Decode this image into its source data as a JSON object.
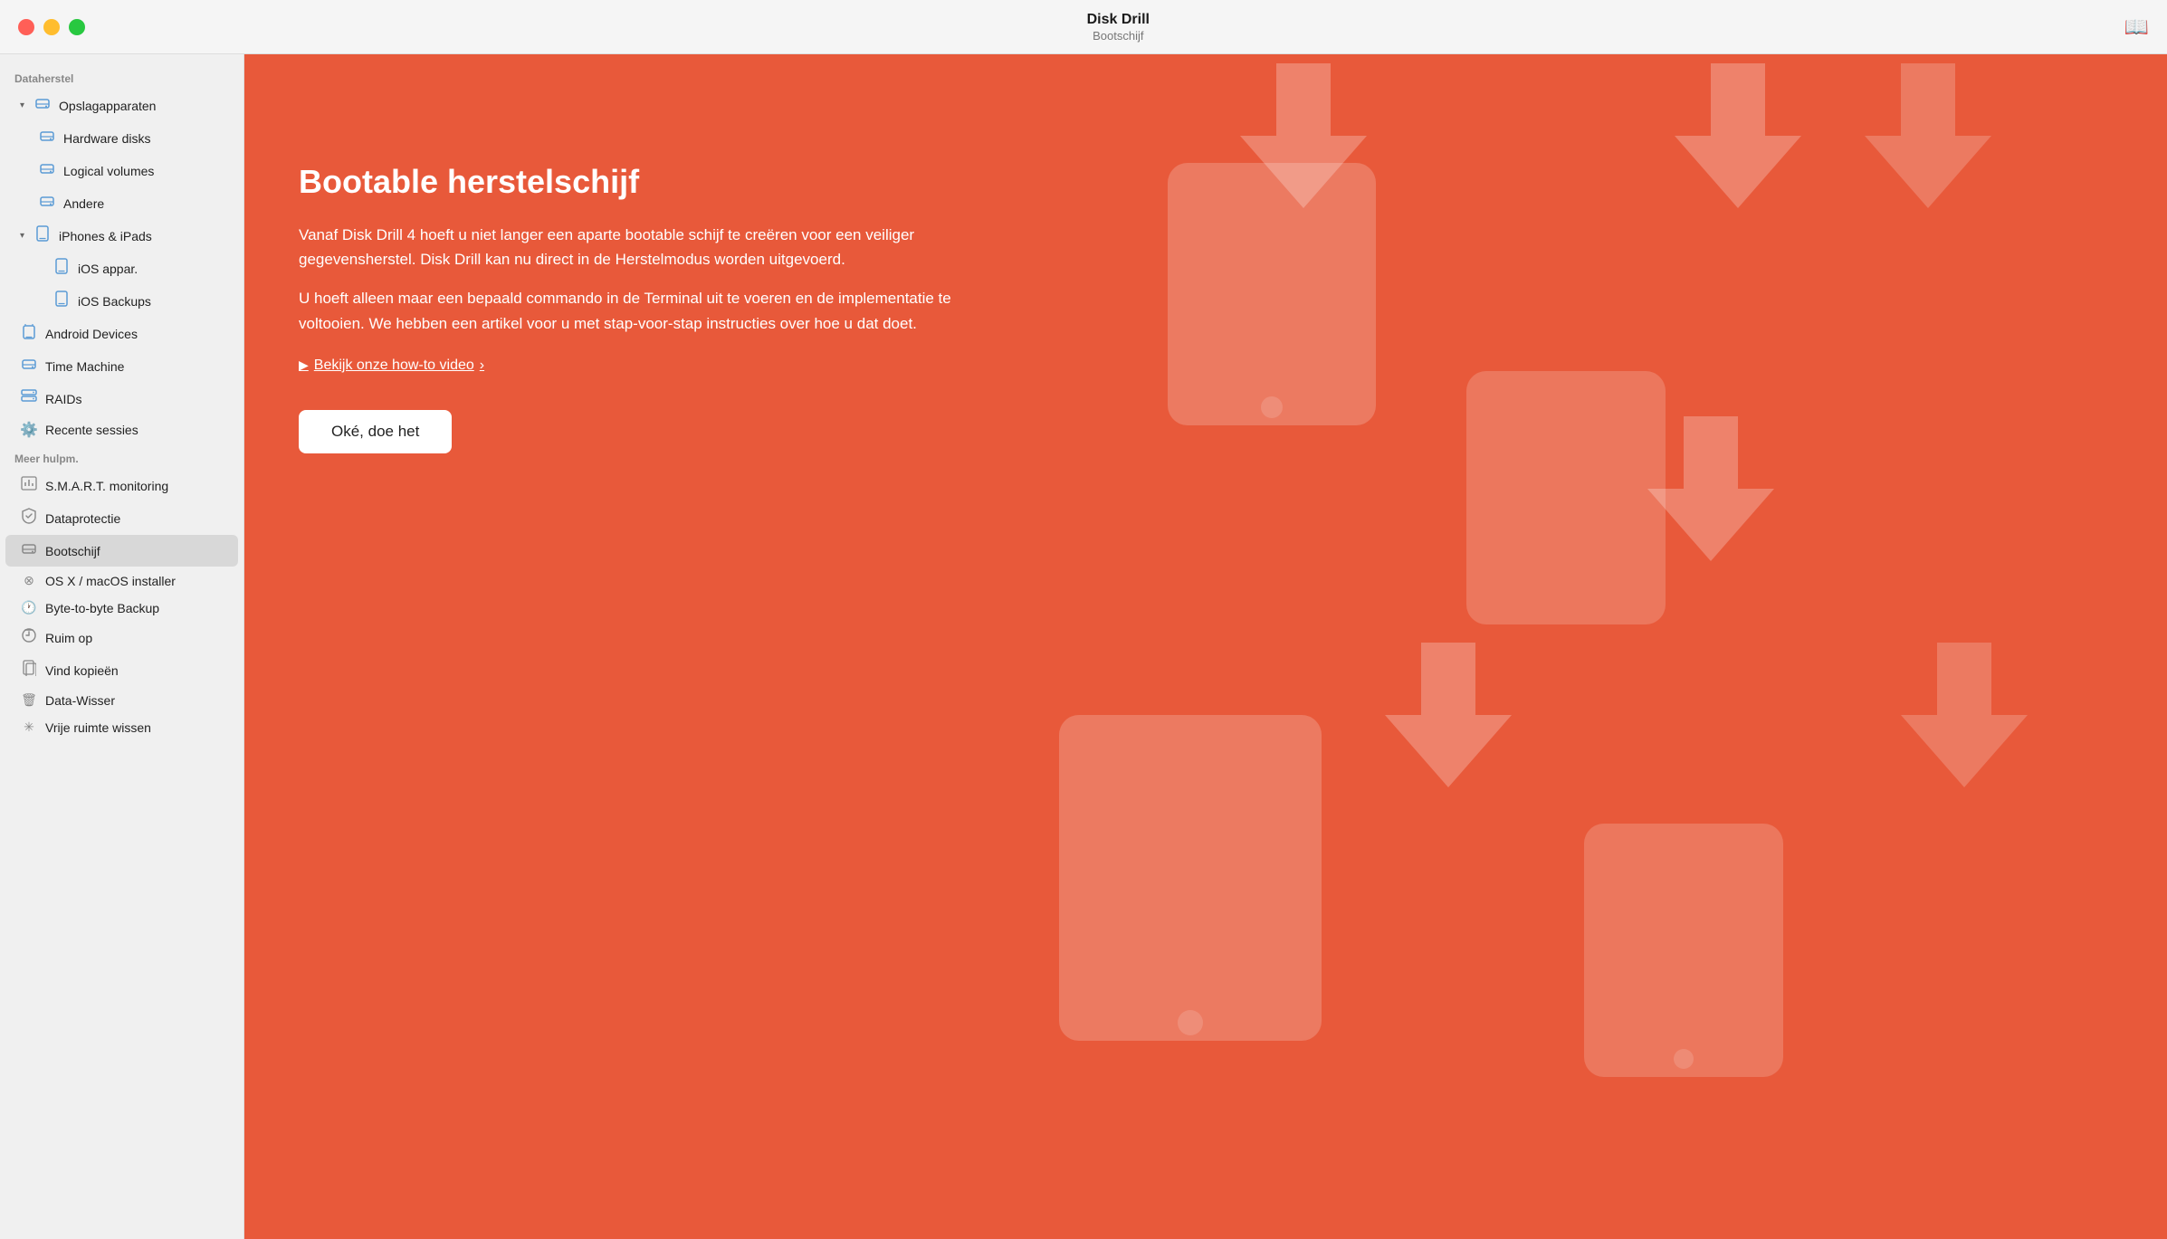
{
  "titlebar": {
    "title": "Disk Drill",
    "subtitle": "Bootschijf",
    "book_icon": "📖"
  },
  "sidebar": {
    "dataherstel_label": "Dataherstel",
    "meer_hulpm_label": "Meer hulpm.",
    "items_dataherstel": [
      {
        "id": "opslagapparaten",
        "label": "Opslagapparaten",
        "icon": "💾",
        "indent": 0,
        "chevron": true,
        "expanded": true
      },
      {
        "id": "hardware-disks",
        "label": "Hardware disks",
        "icon": "💾",
        "indent": 1
      },
      {
        "id": "logical-volumes",
        "label": "Logical volumes",
        "icon": "💾",
        "indent": 1
      },
      {
        "id": "andere",
        "label": "Andere",
        "icon": "💾",
        "indent": 1
      },
      {
        "id": "iphones-ipads",
        "label": "iPhones & iPads",
        "icon": "📱",
        "indent": 0,
        "chevron": true,
        "expanded": true
      },
      {
        "id": "ios-appar",
        "label": "iOS appar.",
        "icon": "📱",
        "indent": 1
      },
      {
        "id": "ios-backups",
        "label": "iOS Backups",
        "icon": "📱",
        "indent": 1
      },
      {
        "id": "android-devices",
        "label": "Android Devices",
        "icon": "📱",
        "indent": 0
      },
      {
        "id": "time-machine",
        "label": "Time Machine",
        "icon": "💾",
        "indent": 0
      },
      {
        "id": "raids",
        "label": "RAIDs",
        "icon": "🗄",
        "indent": 0
      },
      {
        "id": "recente-sessies",
        "label": "Recente sessies",
        "icon": "⚙️",
        "indent": 0
      }
    ],
    "items_meer": [
      {
        "id": "smart-monitoring",
        "label": "S.M.A.R.T. monitoring",
        "icon": "📊",
        "indent": 0
      },
      {
        "id": "dataprotectie",
        "label": "Dataprotectie",
        "icon": "🛡",
        "indent": 0
      },
      {
        "id": "bootschijf",
        "label": "Bootschijf",
        "icon": "💾",
        "indent": 0,
        "active": true
      },
      {
        "id": "osx-installer",
        "label": "OS X / macOS installer",
        "icon": "⊗",
        "indent": 0
      },
      {
        "id": "byte-backup",
        "label": "Byte-to-byte Backup",
        "icon": "🕐",
        "indent": 0
      },
      {
        "id": "ruim-op",
        "label": "Ruim op",
        "icon": "+",
        "indent": 0
      },
      {
        "id": "vind-kopieeen",
        "label": "Vind kopieën",
        "icon": "📄",
        "indent": 0
      },
      {
        "id": "data-wisser",
        "label": "Data-Wisser",
        "icon": "🗑",
        "indent": 0
      },
      {
        "id": "vrije-ruimte",
        "label": "Vrije ruimte wissen",
        "icon": "✳",
        "indent": 0
      }
    ]
  },
  "main": {
    "title": "Bootable herstelschijf",
    "description1": "Vanaf Disk Drill 4 hoeft u niet langer een aparte bootable schijf te creëren voor een veiliger gegevensherstel. Disk Drill kan nu direct in de Herstelmodus worden uitgevoerd.",
    "description2": "U hoeft alleen maar een bepaald commando in de Terminal uit te voeren en de implementatie te voltooien. We hebben een artikel voor u met stap-voor-stap instructies over hoe u dat doet.",
    "link_label": "Bekijk onze how-to video",
    "link_arrow": "›",
    "button_label": "Oké, doe het"
  }
}
